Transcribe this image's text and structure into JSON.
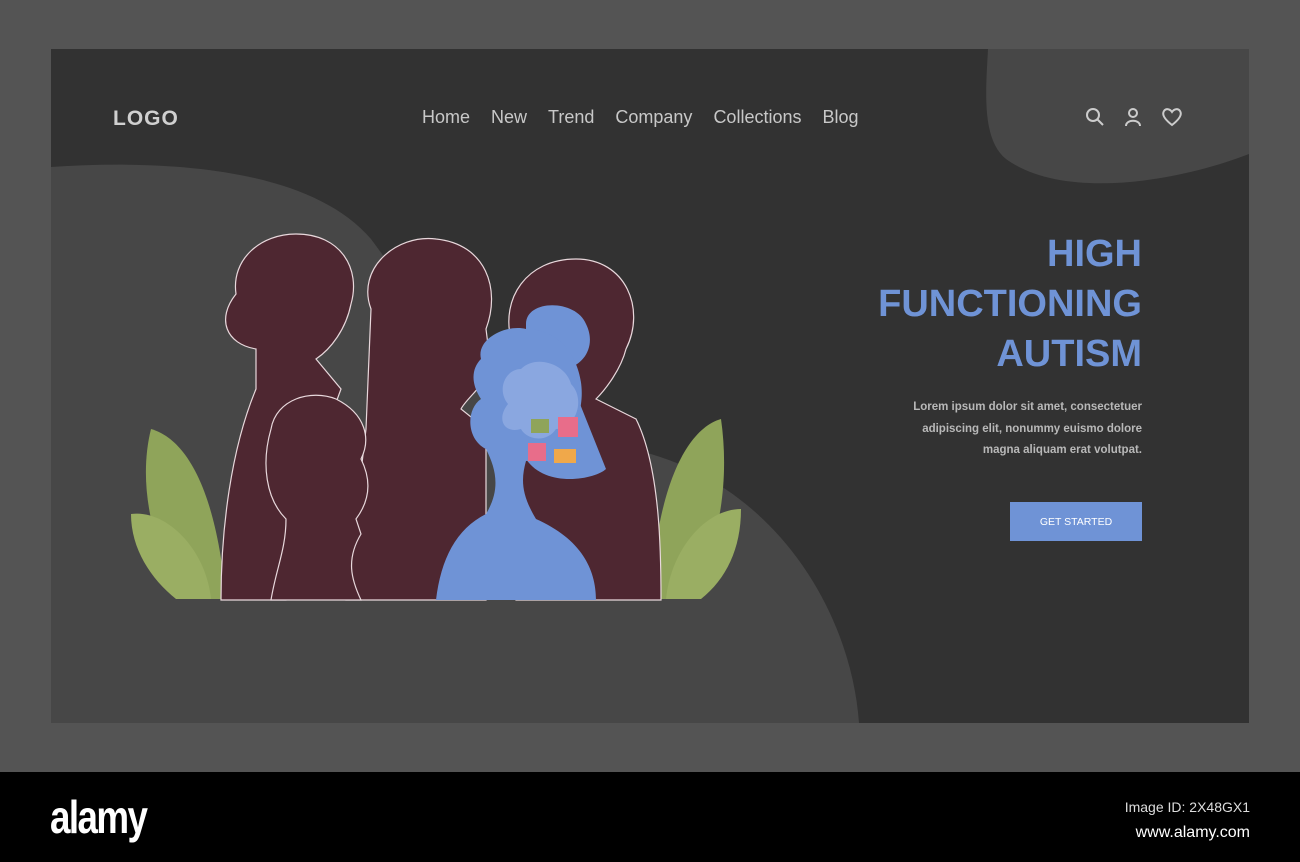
{
  "header": {
    "logo": "LOGO",
    "nav": [
      "Home",
      "New",
      "Trend",
      "Company",
      "Collections",
      "Blog"
    ]
  },
  "hero": {
    "title_lines": [
      "HIGH",
      "FUNCTIONING",
      "AUTISM"
    ],
    "description_lines": [
      "Lorem ipsum dolor sit amet, consectetuer",
      "adipiscing elit, nonummy euismo dolore",
      "magna aliquam erat volutpat."
    ],
    "button": "GET STARTED"
  },
  "footer": {
    "brand": "alamy",
    "image_id": "Image ID: 2X48GX1",
    "url": "www.alamy.com"
  },
  "colors": {
    "accent": "#6f93d6",
    "panel": "#323232",
    "silhouette": "#4e2731",
    "leaf": "#8fa45a"
  }
}
